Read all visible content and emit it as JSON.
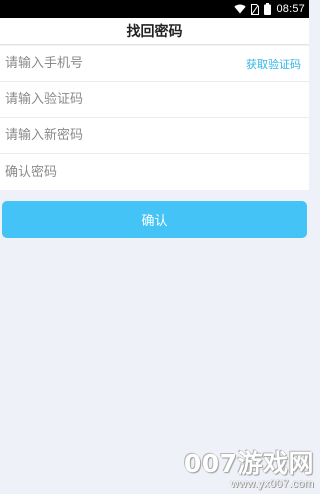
{
  "status_bar": {
    "time": "08:57",
    "icons": [
      "wifi-icon",
      "no-sim-icon",
      "battery-icon"
    ]
  },
  "header": {
    "title": "找回密码"
  },
  "form": {
    "phone_placeholder": "请输入手机号",
    "get_code_label": "获取验证码",
    "code_placeholder": "请输入验证码",
    "new_password_placeholder": "请输入新密码",
    "confirm_password_placeholder": "确认密码"
  },
  "confirm_button": {
    "label": "确认"
  },
  "watermark": {
    "main": "007游戏网",
    "url": "www.yx007.com"
  },
  "colors": {
    "accent": "#44c3f7",
    "link": "#30b4ea",
    "background": "#eef1f8"
  }
}
